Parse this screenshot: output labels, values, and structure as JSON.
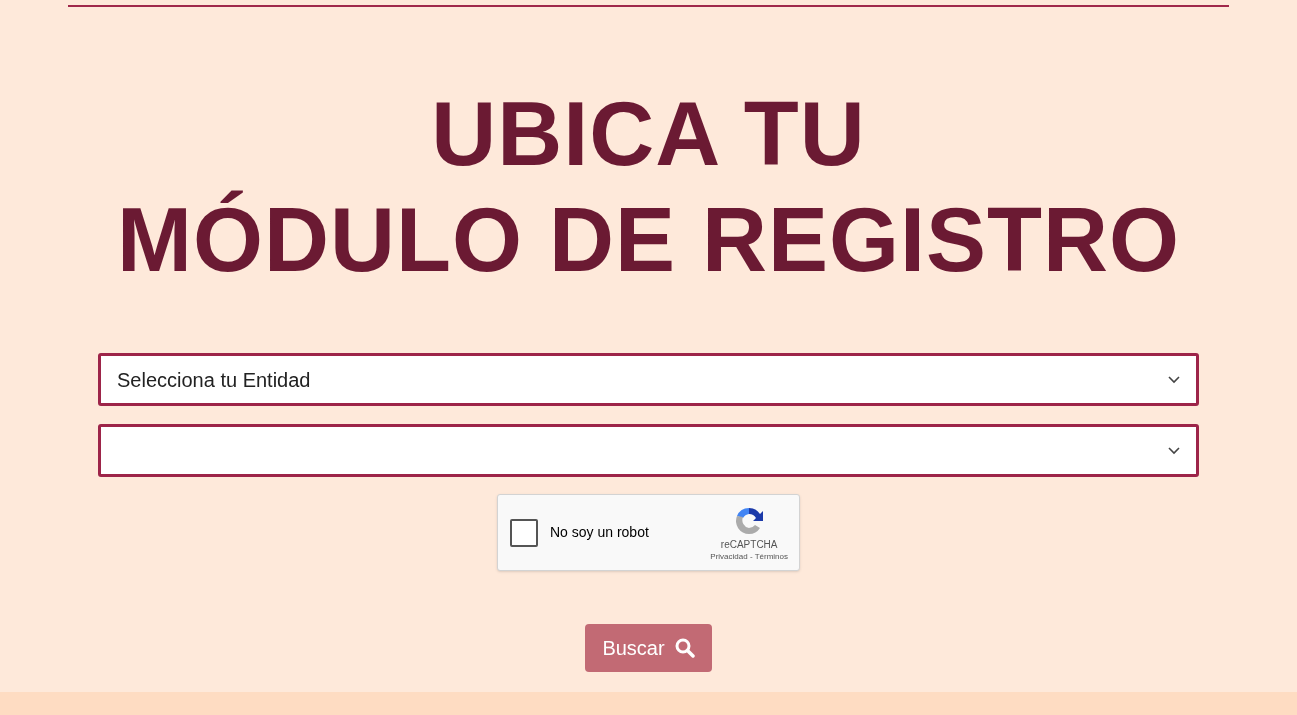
{
  "title_lines": [
    "UBICA TU",
    "MÓDULO DE REGISTRO"
  ],
  "selects": [
    {
      "kind": "dropdown",
      "value": "Selecciona tu Entidad"
    },
    {
      "kind": "dropdown"
    }
  ],
  "captcha": {
    "label": "No soy un robot",
    "checked": false,
    "brand": "reCAPTCHA",
    "links": "Privacidad - Términos"
  },
  "search_button": {
    "label": "Buscar",
    "disabled": true
  }
}
